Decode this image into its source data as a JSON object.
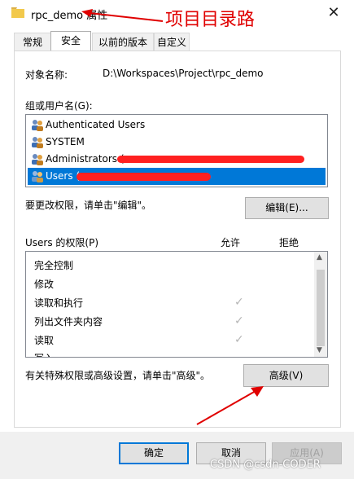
{
  "window": {
    "title": "rpc_demo 属性",
    "annotation": "项目目录路"
  },
  "tabs": [
    {
      "label": "常规"
    },
    {
      "label": "安全"
    },
    {
      "label": "以前的版本"
    },
    {
      "label": "自定义"
    }
  ],
  "object": {
    "label": "对象名称:",
    "value": "D:\\Workspaces\\Project\\rpc_demo"
  },
  "groups": {
    "label": "组或用户名(G):",
    "items": [
      {
        "name": "Authenticated Users",
        "selected": false
      },
      {
        "name": "SYSTEM",
        "selected": false
      },
      {
        "name": "Administrators (",
        "selected": false
      },
      {
        "name": "Users (",
        "selected": true
      }
    ]
  },
  "edit": {
    "hint": "要更改权限，请单击\"编辑\"。",
    "button": "编辑(E)..."
  },
  "permissions": {
    "title": "Users 的权限(P)",
    "allow": "允许",
    "deny": "拒绝",
    "items": [
      {
        "name": "完全控制",
        "allow": false
      },
      {
        "name": "修改",
        "allow": false
      },
      {
        "name": "读取和执行",
        "allow": true
      },
      {
        "name": "列出文件夹内容",
        "allow": true
      },
      {
        "name": "读取",
        "allow": true
      },
      {
        "name": "写入",
        "allow": false
      }
    ]
  },
  "advanced": {
    "hint": "有关特殊权限或高级设置，请单击\"高级\"。",
    "button": "高级(V)"
  },
  "footer": {
    "ok": "确定",
    "cancel": "取消",
    "apply": "应用(A)"
  },
  "watermark": "CSDN @csdn-CODER",
  "colors": {
    "selection": "#0078d7",
    "annotation": "#e00000"
  }
}
